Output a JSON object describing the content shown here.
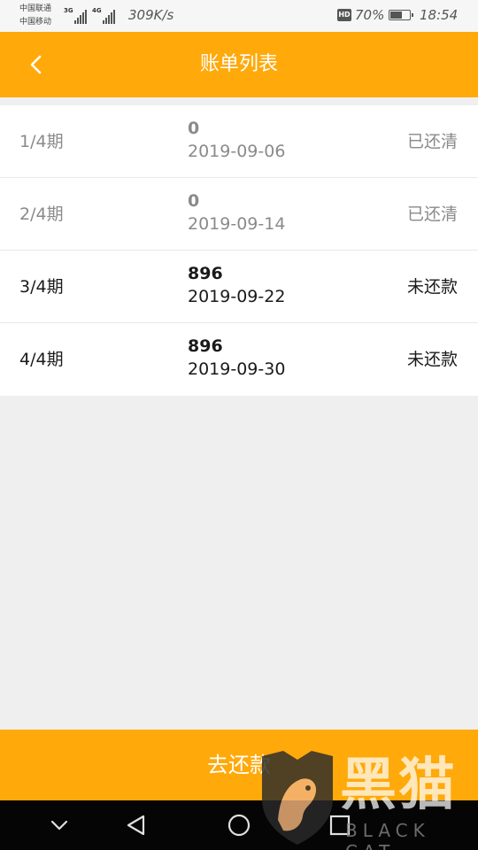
{
  "status_bar": {
    "carrier_1": "中国联通",
    "carrier_2": "中国移动",
    "network_1": "3G",
    "network_2": "4G",
    "speed": "309K/s",
    "hd": "HD",
    "battery": "70%",
    "battery_level": 0.7,
    "time": "18:54"
  },
  "header": {
    "title": "账单列表"
  },
  "bills": [
    {
      "period": "1/4期",
      "amount": "0",
      "date": "2019-09-06",
      "status": "已还清",
      "state": "paid"
    },
    {
      "period": "2/4期",
      "amount": "0",
      "date": "2019-09-14",
      "status": "已还清",
      "state": "paid"
    },
    {
      "period": "3/4期",
      "amount": "896",
      "date": "2019-09-22",
      "status": "未还款",
      "state": "unpaid"
    },
    {
      "period": "4/4期",
      "amount": "896",
      "date": "2019-09-30",
      "status": "未还款",
      "state": "unpaid"
    }
  ],
  "pay_button": {
    "label": "去还款"
  },
  "watermark": {
    "text_cn": "黑猫",
    "text_en": "BLACK CAT"
  },
  "icons": {
    "back": "chevron-left-icon",
    "nav": [
      "chevron-down-icon",
      "triangle-back-icon",
      "circle-home-icon",
      "square-recents-icon"
    ]
  },
  "colors": {
    "accent": "#ffa90a",
    "paid_text": "#8a8a8a",
    "unpaid_text": "#1a1a1a",
    "background": "#efefef",
    "nav_bar": "#050505"
  }
}
